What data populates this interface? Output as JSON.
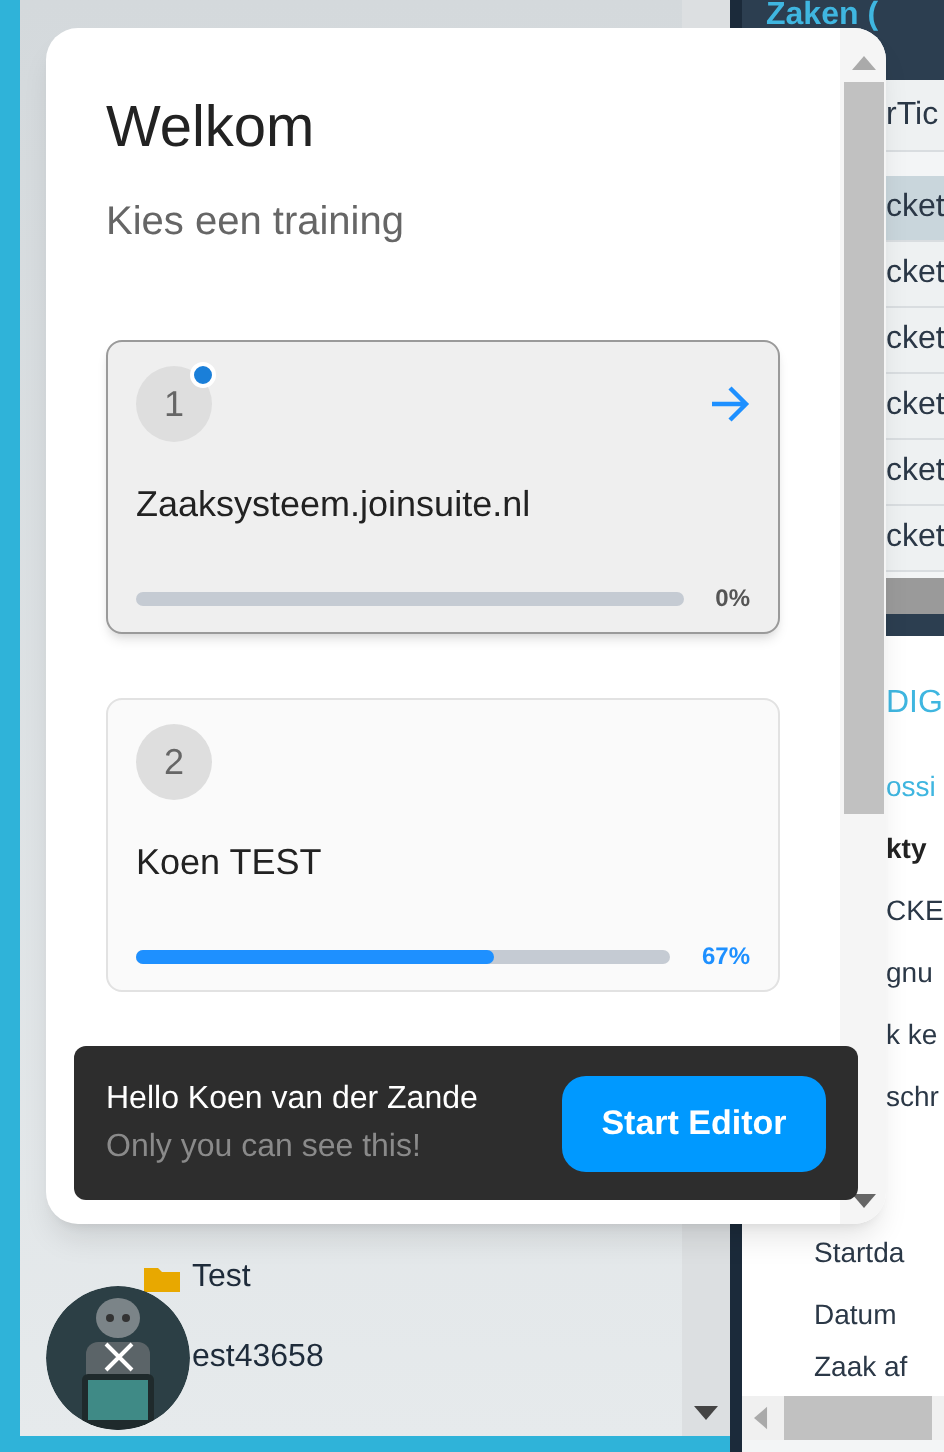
{
  "background": {
    "left_items": [
      {
        "label": "Test",
        "kind": "folder"
      },
      {
        "label": "est43658",
        "kind": "plain"
      }
    ],
    "right_header": "Zaken (",
    "right_rows": [
      {
        "label": "rTic",
        "selected": false
      },
      {
        "label": "cket",
        "selected": true
      },
      {
        "label": "cket",
        "selected": false
      },
      {
        "label": "cket",
        "selected": false
      },
      {
        "label": "cket",
        "selected": false
      },
      {
        "label": "cket",
        "selected": false
      },
      {
        "label": "cket",
        "selected": false
      }
    ],
    "right_section": "DIG",
    "right_lines": [
      {
        "label": "ossi",
        "kind": "link"
      },
      {
        "label": "kty",
        "kind": "bold"
      },
      {
        "label": "CKE",
        "kind": "plain"
      },
      {
        "label": "gnu",
        "kind": "plain"
      },
      {
        "label": "k ke",
        "kind": "plain"
      },
      {
        "label": "schr",
        "kind": "plain"
      },
      {
        "label": "Startda",
        "kind": "plain"
      },
      {
        "label": "Datum",
        "kind": "plain"
      },
      {
        "label": "Zaak af",
        "kind": "plain"
      }
    ]
  },
  "dialog": {
    "title": "Welkom",
    "subtitle": "Kies een training",
    "trainings": [
      {
        "number": "1",
        "name": "Zaaksysteem.joinsuite.nl",
        "level": 0,
        "percent": "0%",
        "selected": true
      },
      {
        "number": "2",
        "name": "Koen TEST",
        "level": 0.67,
        "percent": "67%",
        "selected": false
      }
    ]
  },
  "toast": {
    "greeting": "Hello Koen van der Zande",
    "note": "Only you can see this!",
    "button": "Start Editor"
  }
}
